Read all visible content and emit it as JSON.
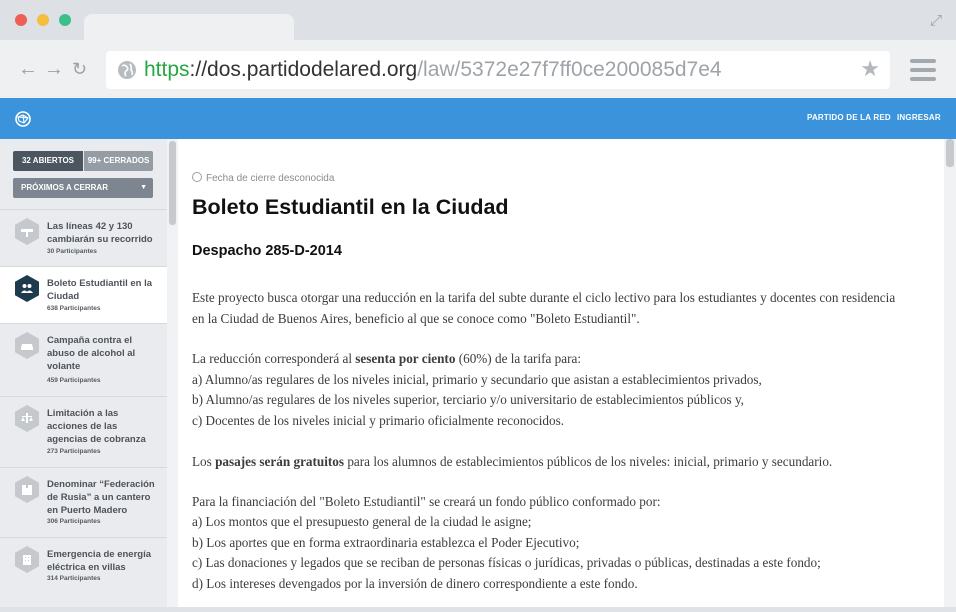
{
  "browser": {
    "url_scheme": "https",
    "url_separator": "://",
    "url_host": "dos.partidodelared.org",
    "url_path": "/law/5372e27f7ff0ce200085d7e4",
    "colors": {
      "window_close": "#ee5f55",
      "window_minimize": "#f5be3d",
      "window_maximize": "#3cc08b",
      "scheme": "#27a644"
    }
  },
  "header": {
    "links": [
      "PARTIDO DE LA RED",
      "INGRESAR"
    ],
    "color": "#3a93db"
  },
  "sidebar": {
    "filters": {
      "open": "32 ABIERTOS",
      "closed": "99+ CERRADOS"
    },
    "sort_label": "PRÓXIMOS A CERRAR",
    "items": [
      {
        "title": "Las líneas 42 y 130 cambiarán su recorrido",
        "count": "30 Participantes",
        "icon": "transport-icon"
      },
      {
        "title": "Boleto Estudiantil en la Ciudad",
        "count": "638 Participantes",
        "icon": "people-icon",
        "active": true
      },
      {
        "title": "Campaña contra el abuso de alcohol al volante",
        "count": "459 Participantes",
        "icon": "car-icon"
      },
      {
        "title": "Limitación a las acciones de las agencias de cobranza",
        "count": "273 Participantes",
        "icon": "justice-icon"
      },
      {
        "title": "Denominar “Federación de Rusia” a un cantero en Puerto Madero",
        "count": "306 Participantes",
        "icon": "puzzle-icon"
      },
      {
        "title": "Emergencia de energía eléctrica en villas",
        "count": "314 Participantes",
        "icon": "building-icon"
      }
    ]
  },
  "main": {
    "close_date": "Fecha de cierre desconocida",
    "title": "Boleto Estudiantil en la Ciudad",
    "subtitle": "Despacho 285-D-2014",
    "p1": "Este proyecto busca otorgar una reducción en la tarifa del subte durante el ciclo lectivo para los estudiantes y docentes con residencia en la Ciudad de Buenos Aires, beneficio al que se conoce como \"Boleto Estudiantil\".",
    "p2_pre": "La reducción corresponderá al ",
    "p2_bold": "sesenta por ciento",
    "p2_post": " (60%) de la tarifa para:",
    "p2_a": "a) Alumno/as regulares de los niveles inicial, primario y secundario que asistan a establecimientos privados,",
    "p2_b": "b) Alumno/as regulares de los niveles superior, terciario y/o universitario de establecimientos públicos y,",
    "p2_c": "c) Docentes de los niveles inicial y primario oficialmente reconocidos.",
    "p3_pre": "Los ",
    "p3_bold": "pasajes serán gratuitos",
    "p3_post": " para los alumnos de establecimientos públicos de los niveles: inicial, primario y secundario.",
    "p4": "Para la financiación del \"Boleto Estudiantil\" se creará un fondo público conformado por:",
    "p4_a": "a) Los montos que el presupuesto general de la ciudad le asigne;",
    "p4_b": "b) Los aportes que en forma extraordinaria establezca el Poder Ejecutivo;",
    "p4_c": "c) Las donaciones y legados que se reciban de personas físicas o jurídicas, privadas o públicas, destinadas a este fondo;",
    "p4_d": "d) Los intereses devengados por la inversión de dinero correspondiente a este fondo."
  }
}
